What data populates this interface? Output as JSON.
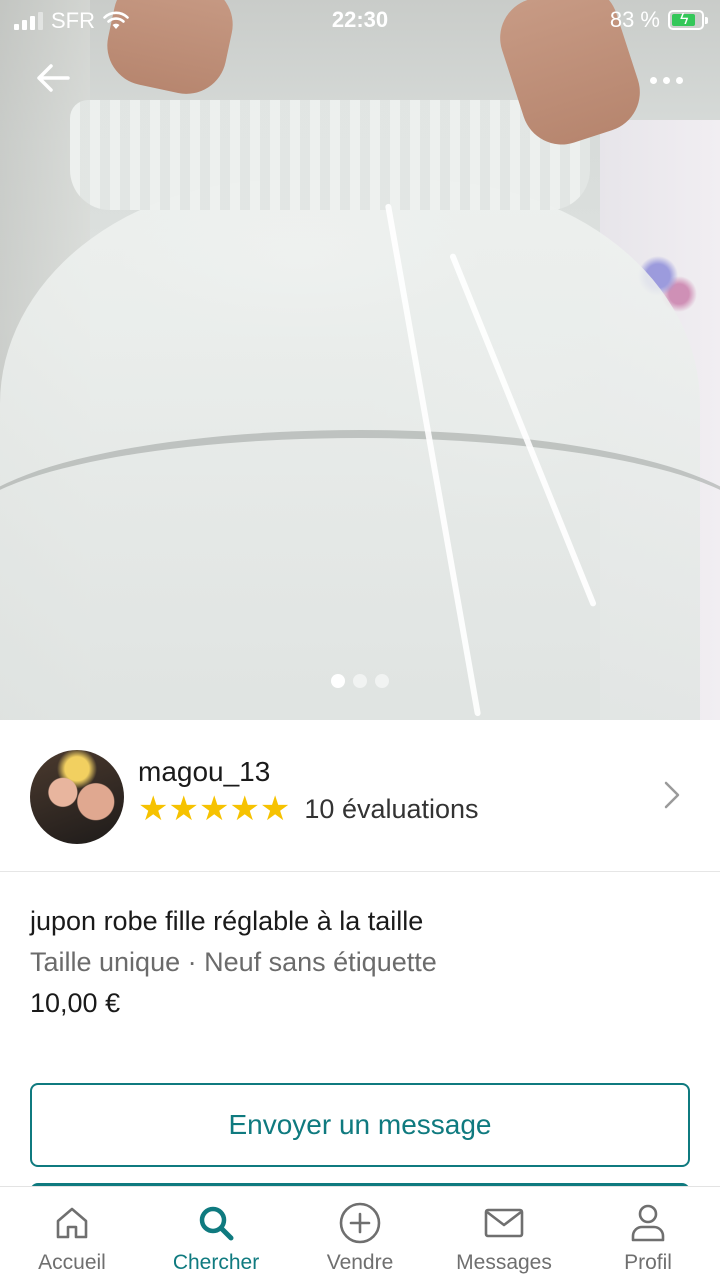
{
  "status_bar": {
    "carrier": "SFR",
    "time": "22:30",
    "battery": "83 %",
    "battery_level": 0.83,
    "charging": true
  },
  "photo": {
    "image_count": 3,
    "active_index": 0
  },
  "seller": {
    "username": "magou_13",
    "stars": 5,
    "stars_glyphs": "★★★★★",
    "reviews": "10 évaluations"
  },
  "item": {
    "title": "jupon robe fille réglable à la taille",
    "meta": "Taille unique · Neuf sans étiquette",
    "price": "10,00 €"
  },
  "actions": {
    "message_button": "Envoyer un message"
  },
  "tabbar": {
    "accent": "#0f7a7f",
    "items": [
      {
        "label": "Accueil",
        "icon": "home-icon",
        "active": false
      },
      {
        "label": "Chercher",
        "icon": "search-icon",
        "active": true
      },
      {
        "label": "Vendre",
        "icon": "plus-circle-icon",
        "active": false
      },
      {
        "label": "Messages",
        "icon": "mail-icon",
        "active": false
      },
      {
        "label": "Profil",
        "icon": "user-icon",
        "active": false
      }
    ]
  }
}
